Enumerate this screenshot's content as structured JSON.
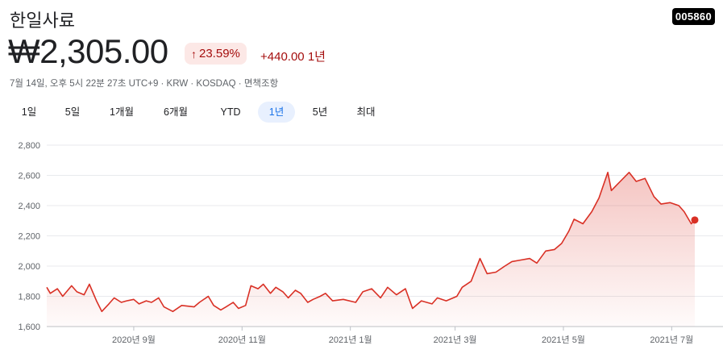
{
  "header": {
    "company_name": "한일사료",
    "ticker": "005860",
    "price": "₩2,305.00",
    "pct_change": "23.59%",
    "abs_change": "+440.00",
    "period_label": "1년",
    "meta": "7월 14일, 오후 5시 22분 27초 UTC+9 · KRW · KOSDAQ · 면책조항"
  },
  "colors": {
    "accent": "#1a73e8",
    "down_red": "#d93025",
    "badge_bg": "#fce8e6",
    "badge_text": "#a50e0e"
  },
  "icons": {
    "change_arrow": "arrow-up-icon"
  },
  "tabs": [
    {
      "label": "1일",
      "active": false
    },
    {
      "label": "5일",
      "active": false
    },
    {
      "label": "1개월",
      "active": false
    },
    {
      "label": "6개월",
      "active": false
    },
    {
      "label": "YTD",
      "active": false
    },
    {
      "label": "1년",
      "active": true
    },
    {
      "label": "5년",
      "active": false
    },
    {
      "label": "최대",
      "active": false
    }
  ],
  "chart_data": {
    "type": "area",
    "title": "",
    "xlabel": "",
    "ylabel": "",
    "ylim": [
      1600,
      2800
    ],
    "y_ticks": [
      "2,800",
      "2,600",
      "2,400",
      "2,200",
      "2,000",
      "1,800",
      "1,600"
    ],
    "y_tick_values": [
      2800,
      2600,
      2400,
      2200,
      2000,
      1800,
      1600
    ],
    "x_ticks": [
      "2020년 9월",
      "2020년 11월",
      "2021년 1월",
      "2021년 3월",
      "2021년 5월",
      "2021년 7월"
    ],
    "x_tick_dates": [
      "2020-09-01",
      "2020-11-01",
      "2021-01-01",
      "2021-03-01",
      "2021-05-01",
      "2021-07-01"
    ],
    "grid": true,
    "series": [
      {
        "x": [
          "2020-07-14",
          "2020-07-16",
          "2020-07-20",
          "2020-07-23",
          "2020-07-28",
          "2020-07-31",
          "2020-08-04",
          "2020-08-07",
          "2020-08-11",
          "2020-08-14",
          "2020-08-18",
          "2020-08-21",
          "2020-08-25",
          "2020-08-28",
          "2020-09-01",
          "2020-09-04",
          "2020-09-08",
          "2020-09-11",
          "2020-09-15",
          "2020-09-18",
          "2020-09-23",
          "2020-09-28",
          "2020-10-05",
          "2020-10-08",
          "2020-10-13",
          "2020-10-16",
          "2020-10-20",
          "2020-10-23",
          "2020-10-27",
          "2020-10-30",
          "2020-11-03",
          "2020-11-06",
          "2020-11-10",
          "2020-11-13",
          "2020-11-17",
          "2020-11-20",
          "2020-11-24",
          "2020-11-27",
          "2020-12-01",
          "2020-12-04",
          "2020-12-08",
          "2020-12-11",
          "2020-12-15",
          "2020-12-18",
          "2020-12-22",
          "2020-12-28",
          "2021-01-04",
          "2021-01-08",
          "2021-01-13",
          "2021-01-18",
          "2021-01-22",
          "2021-01-27",
          "2021-02-01",
          "2021-02-05",
          "2021-02-10",
          "2021-02-16",
          "2021-02-19",
          "2021-02-24",
          "2021-03-02",
          "2021-03-05",
          "2021-03-10",
          "2021-03-15",
          "2021-03-19",
          "2021-03-24",
          "2021-03-29",
          "2021-04-02",
          "2021-04-07",
          "2021-04-12",
          "2021-04-16",
          "2021-04-21",
          "2021-04-26",
          "2021-04-30",
          "2021-05-04",
          "2021-05-07",
          "2021-05-12",
          "2021-05-17",
          "2021-05-21",
          "2021-05-26",
          "2021-05-28",
          "2021-06-02",
          "2021-06-07",
          "2021-06-11",
          "2021-06-16",
          "2021-06-21",
          "2021-06-25",
          "2021-06-30",
          "2021-07-05",
          "2021-07-08",
          "2021-07-12",
          "2021-07-14"
        ],
        "values": [
          1860,
          1820,
          1850,
          1800,
          1870,
          1830,
          1810,
          1880,
          1770,
          1700,
          1750,
          1790,
          1760,
          1770,
          1780,
          1750,
          1770,
          1760,
          1790,
          1730,
          1700,
          1740,
          1730,
          1760,
          1800,
          1740,
          1710,
          1730,
          1760,
          1720,
          1740,
          1870,
          1850,
          1880,
          1820,
          1860,
          1830,
          1790,
          1840,
          1820,
          1760,
          1780,
          1800,
          1820,
          1770,
          1780,
          1760,
          1830,
          1850,
          1790,
          1860,
          1810,
          1850,
          1720,
          1770,
          1750,
          1790,
          1770,
          1800,
          1860,
          1900,
          2050,
          1950,
          1960,
          2000,
          2030,
          2040,
          2050,
          2020,
          2100,
          2110,
          2150,
          2230,
          2310,
          2280,
          2360,
          2450,
          2620,
          2500,
          2560,
          2620,
          2560,
          2580,
          2460,
          2410,
          2420,
          2400,
          2360,
          2280,
          2305
        ]
      }
    ]
  }
}
